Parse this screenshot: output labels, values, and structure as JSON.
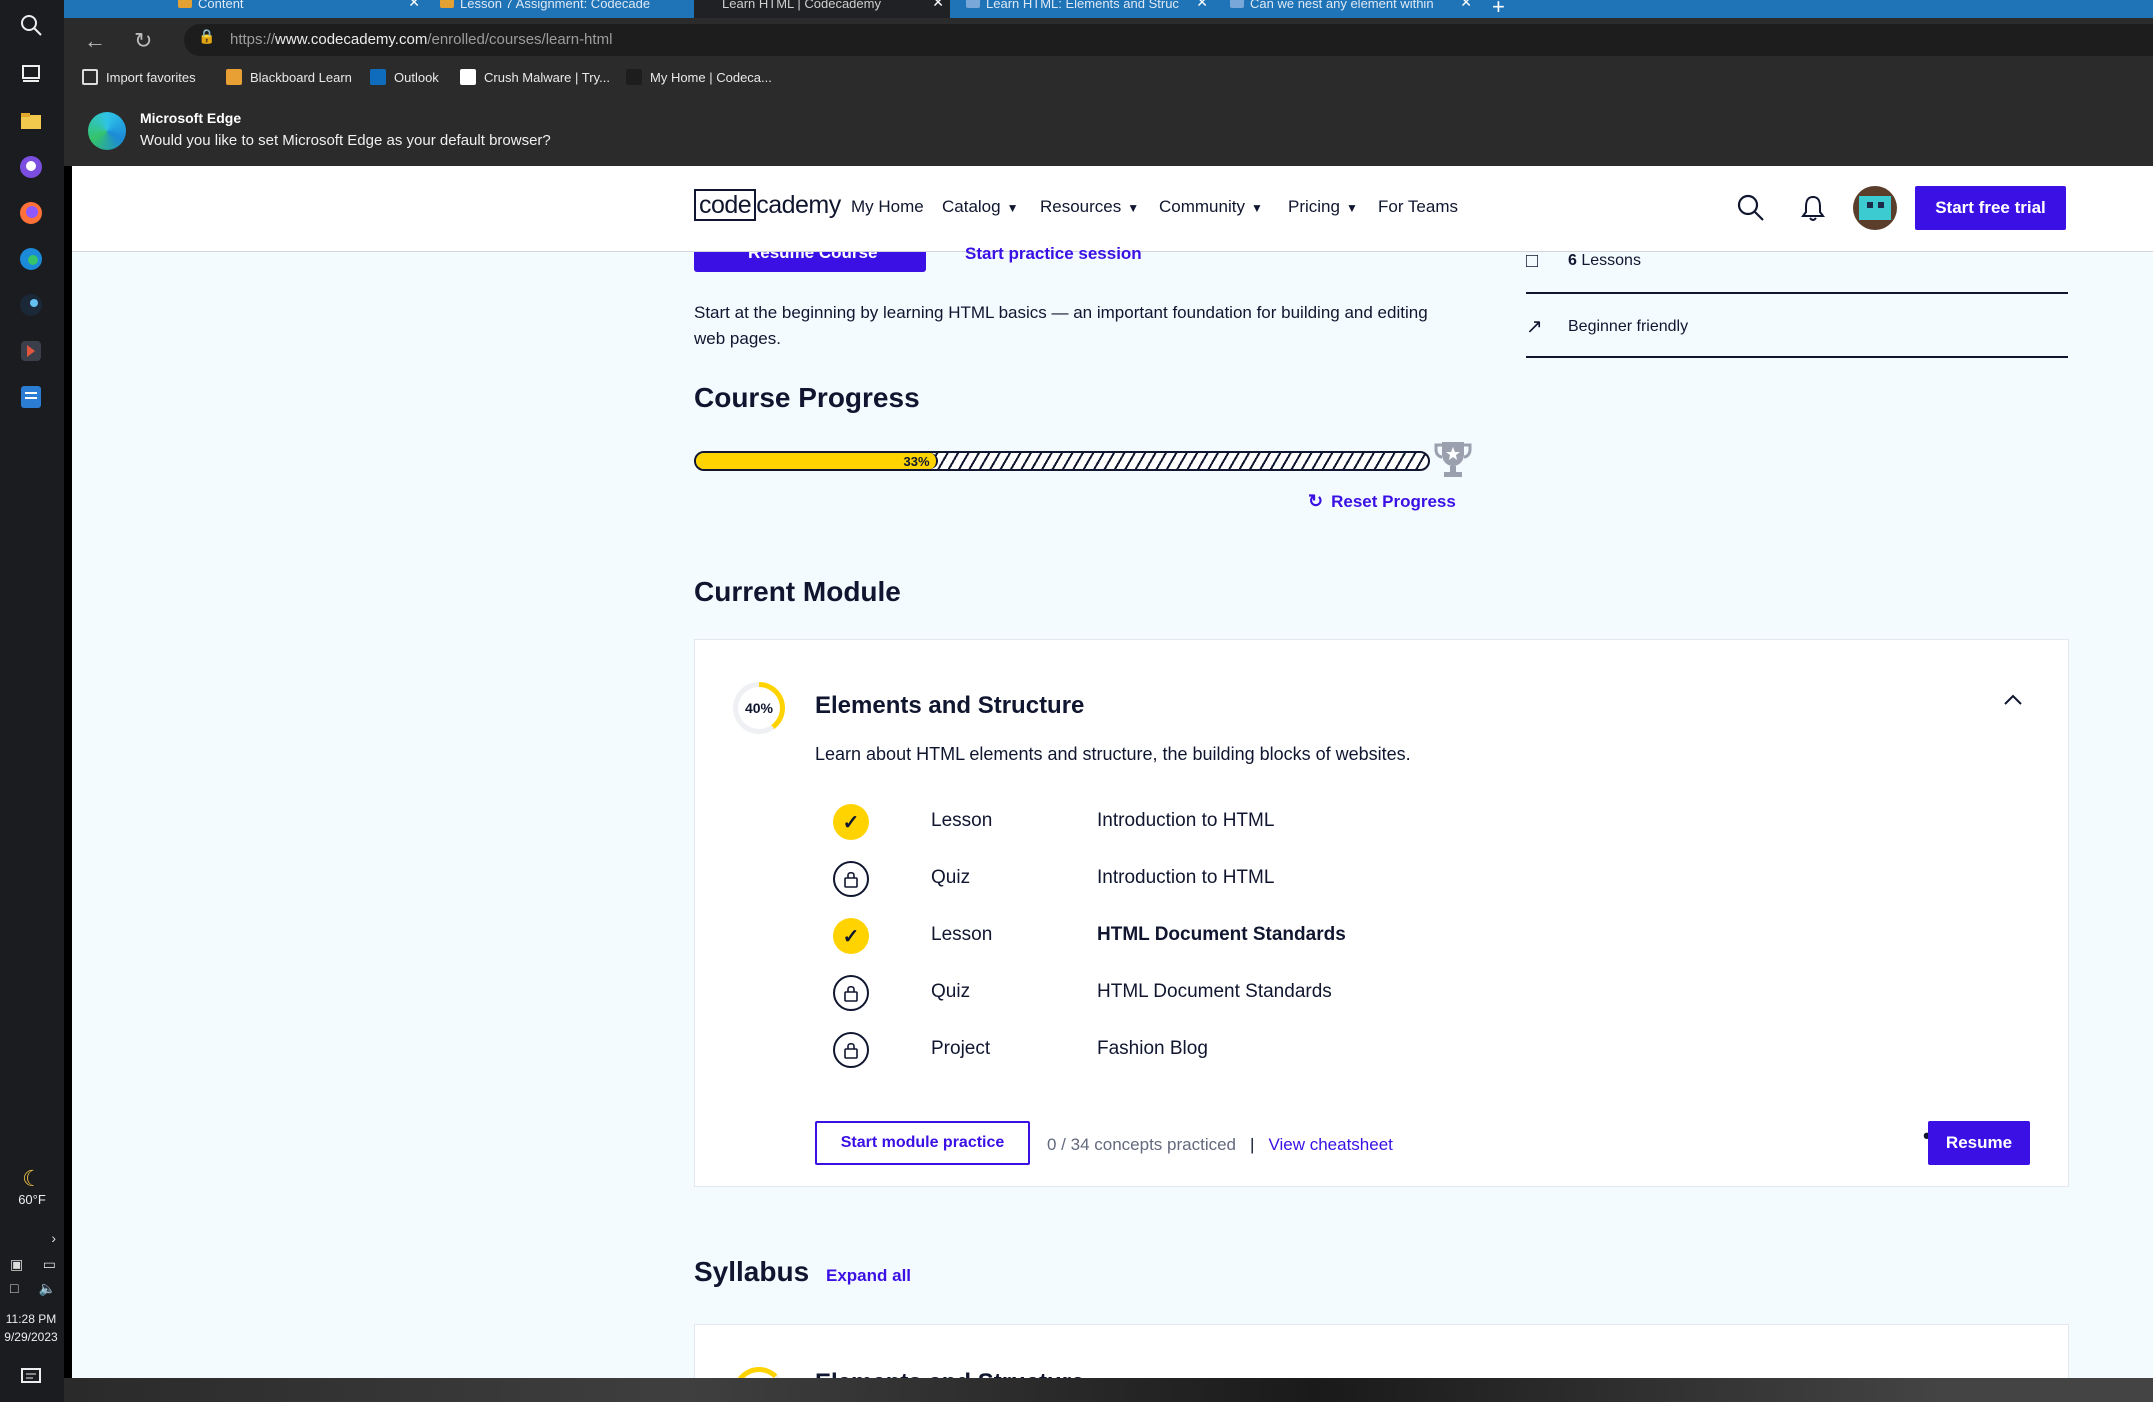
{
  "taskbar": {
    "weather_temp": "60°F",
    "time": "11:28 PM",
    "date": "9/29/2023"
  },
  "browser": {
    "tabs": [
      {
        "label": "Content"
      },
      {
        "label": "Lesson 7 Assignment: Codecade"
      },
      {
        "label": "Learn HTML | Codecademy"
      },
      {
        "label": "Learn HTML: Elements and Struc"
      },
      {
        "label": "Can we nest any element within"
      }
    ],
    "url_prefix": "https://",
    "url_domain": "www.codecademy.com",
    "url_path": "/enrolled/courses/learn-html",
    "favorites": [
      {
        "label": "Import favorites"
      },
      {
        "label": "Blackboard Learn"
      },
      {
        "label": "Outlook"
      },
      {
        "label": "Crush Malware | Try..."
      },
      {
        "label": "My Home | Codeca..."
      }
    ],
    "notification": {
      "title": "Microsoft Edge",
      "text": "Would you like to set Microsoft Edge as your default browser?"
    }
  },
  "nav": {
    "logo_box": "code",
    "logo_rest": "cademy",
    "links": [
      {
        "label": "My Home"
      },
      {
        "label": "Catalog"
      },
      {
        "label": "Resources"
      },
      {
        "label": "Community"
      },
      {
        "label": "Pricing"
      },
      {
        "label": "For Teams"
      }
    ],
    "cta": "Start free trial"
  },
  "course": {
    "resume_label": "Resume Course",
    "practice_link": "Start practice session",
    "description": "Start at the beginning by learning HTML basics — an important foundation for building and editing web pages.",
    "side": {
      "lessons_count": "6",
      "lessons_label": "Lessons",
      "level": "Beginner friendly"
    },
    "progress_heading": "Course Progress",
    "progress_percent_label": "33%",
    "progress_value": 0.33,
    "reset_label": "Reset Progress"
  },
  "current_module": {
    "heading": "Current Module",
    "percent_label": "40%",
    "percent_value": 0.4,
    "title": "Elements and Structure",
    "description": "Learn about HTML elements and structure, the building blocks of websites.",
    "items": [
      {
        "kind": "Lesson",
        "name": "Introduction to HTML",
        "status": "complete"
      },
      {
        "kind": "Quiz",
        "name": "Introduction to HTML",
        "status": "locked"
      },
      {
        "kind": "Lesson",
        "name": "HTML Document Standards",
        "status": "complete"
      },
      {
        "kind": "Quiz",
        "name": "HTML Document Standards",
        "status": "locked"
      },
      {
        "kind": "Project",
        "name": "Fashion Blog",
        "status": "locked"
      }
    ],
    "practice_button": "Start module practice",
    "concepts": "0 / 34 concepts practiced",
    "separator": "|",
    "cheatsheet": "View cheatsheet",
    "more": "•••",
    "resume_button": "Resume"
  },
  "syllabus": {
    "heading": "Syllabus",
    "expand_label": "Expand all",
    "first_module_title": "Elements and Structure"
  },
  "colors": {
    "brand": "#3a10e5",
    "progress_yellow": "#ffd300",
    "ink": "#10162f",
    "page_bg": "#f4fbff"
  }
}
